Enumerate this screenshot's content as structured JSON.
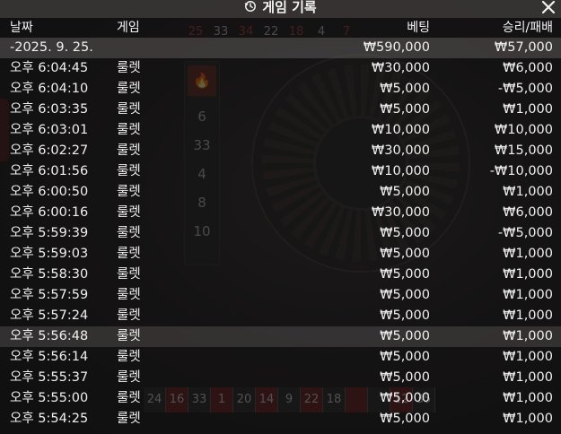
{
  "background": {
    "number_strip": [
      "25",
      "33",
      "34",
      "22",
      "18",
      "4",
      "7"
    ],
    "history_column": [
      "6",
      "33",
      "4",
      "8",
      "10"
    ],
    "table_numbers": [
      "24",
      "16",
      "33",
      "1",
      "20",
      "14",
      "9",
      "22",
      "18",
      "",
      "",
      "12",
      "35"
    ]
  },
  "history": {
    "title": "게임 기록",
    "columns": {
      "date": "날짜",
      "game": "게임",
      "bet": "베팅",
      "result": "승리/패배"
    },
    "summary": {
      "date": "-2025. 9. 25.",
      "game": "",
      "bet": "₩590,000",
      "result": "₩57,000"
    },
    "rows": [
      {
        "time": "오후 6:04:45",
        "game": "룰렛",
        "bet": "₩30,000",
        "result": "₩6,000"
      },
      {
        "time": "오후 6:04:10",
        "game": "룰렛",
        "bet": "₩5,000",
        "result": "-₩5,000"
      },
      {
        "time": "오후 6:03:35",
        "game": "룰렛",
        "bet": "₩5,000",
        "result": "₩1,000"
      },
      {
        "time": "오후 6:03:01",
        "game": "룰렛",
        "bet": "₩10,000",
        "result": "₩10,000"
      },
      {
        "time": "오후 6:02:27",
        "game": "룰렛",
        "bet": "₩30,000",
        "result": "₩15,000"
      },
      {
        "time": "오후 6:01:56",
        "game": "룰렛",
        "bet": "₩10,000",
        "result": "-₩10,000"
      },
      {
        "time": "오후 6:00:50",
        "game": "룰렛",
        "bet": "₩5,000",
        "result": "₩1,000"
      },
      {
        "time": "오후 6:00:16",
        "game": "룰렛",
        "bet": "₩30,000",
        "result": "₩6,000"
      },
      {
        "time": "오후 5:59:39",
        "game": "룰렛",
        "bet": "₩5,000",
        "result": "-₩5,000"
      },
      {
        "time": "오후 5:59:03",
        "game": "룰렛",
        "bet": "₩5,000",
        "result": "₩1,000"
      },
      {
        "time": "오후 5:58:30",
        "game": "룰렛",
        "bet": "₩5,000",
        "result": "₩1,000"
      },
      {
        "time": "오후 5:57:59",
        "game": "룰렛",
        "bet": "₩5,000",
        "result": "₩1,000"
      },
      {
        "time": "오후 5:57:24",
        "game": "룰렛",
        "bet": "₩5,000",
        "result": "₩1,000"
      },
      {
        "time": "오후 5:56:48",
        "game": "룰렛",
        "bet": "₩5,000",
        "result": "₩1,000"
      },
      {
        "time": "오후 5:56:14",
        "game": "룰렛",
        "bet": "₩5,000",
        "result": "₩1,000"
      },
      {
        "time": "오후 5:55:37",
        "game": "룰렛",
        "bet": "₩5,000",
        "result": "₩1,000"
      },
      {
        "time": "오후 5:55:00",
        "game": "룰렛",
        "bet": "₩5,000",
        "result": "₩1,000"
      },
      {
        "time": "오후 5:54:25",
        "game": "룰렛",
        "bet": "₩5,000",
        "result": "₩1,000"
      }
    ]
  }
}
